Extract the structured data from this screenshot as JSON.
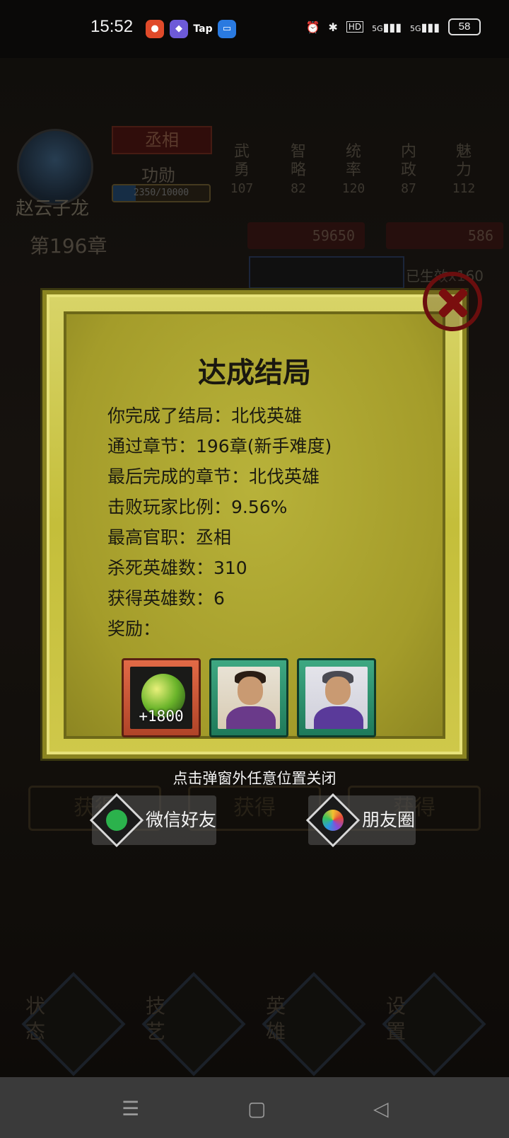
{
  "status_bar": {
    "time": "15:52",
    "apps": [
      "Tap"
    ],
    "network_a": "HD",
    "network_b": "5G",
    "network_c": "5G",
    "battery": "58"
  },
  "background": {
    "hero_name": "赵云子龙",
    "chapter": "第196章",
    "rank": "丞相",
    "merit_label": "功勋",
    "merit_text": "2350/10000",
    "merit_progress": 0.235,
    "stats": [
      {
        "label": "武勇",
        "value": "107"
      },
      {
        "label": "智略",
        "value": "82"
      },
      {
        "label": "统率",
        "value": "120"
      },
      {
        "label": "内政",
        "value": "87"
      },
      {
        "label": "魅力",
        "value": "112"
      }
    ],
    "gold": "59650",
    "food": "586",
    "effect_text": "已生效x160",
    "obtain_buttons": [
      "获得",
      "获得",
      "获得"
    ],
    "bottom_tabs": [
      "状态",
      "技艺",
      "英雄",
      "设置"
    ]
  },
  "dialog": {
    "title": "达成结局",
    "lines": [
      "你完成了结局：北伐英雄",
      "通过章节：196章(新手难度)",
      "最后完成的章节：北伐英雄",
      "击败玩家比例：9.56%",
      "最高官职：丞相",
      "杀死英雄数：310",
      "获得英雄数：6",
      "奖励："
    ],
    "rewards": [
      {
        "type": "item",
        "label": "+1800",
        "frame": "orange"
      },
      {
        "type": "hero",
        "label": "",
        "frame": "green"
      },
      {
        "type": "hero",
        "label": "",
        "frame": "green"
      }
    ],
    "hint": "点击弹窗外任意位置关闭"
  },
  "share": {
    "wechat_friend": "微信好友",
    "moments": "朋友圈"
  },
  "navbar": {
    "menu": "☰",
    "home": "▢",
    "back": "◁"
  }
}
